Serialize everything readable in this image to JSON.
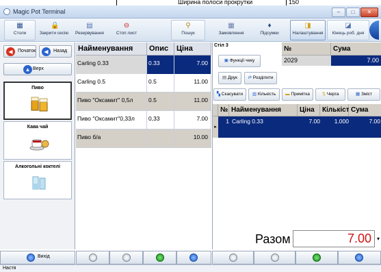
{
  "top": {
    "strip_label": "Ширина полоси прокрутки",
    "strip_value": "150"
  },
  "window": {
    "title": "Magic Pot Terminal"
  },
  "toolbar": {
    "items": [
      {
        "label": "Столи",
        "icon": "grid-icon"
      },
      {
        "label": "Закрити сесію",
        "icon": "lock-icon"
      },
      {
        "label": "Резервування",
        "icon": "calendar-icon"
      },
      {
        "label": "Стоп лист",
        "icon": "stop-icon"
      },
      {
        "label": "Пошук",
        "icon": "search-icon"
      },
      {
        "label": "Замовлення",
        "icon": "orders-icon"
      },
      {
        "label": "Підсумки",
        "icon": "totals-icon"
      },
      {
        "label": "Налаштування",
        "icon": "settings-icon"
      },
      {
        "label": "Кінець роб. дня",
        "icon": "end-day-icon"
      }
    ]
  },
  "left": {
    "start_label": "Початок",
    "back_label": "Назад",
    "up_label": "Верх",
    "exit_label": "Вихід",
    "categories": [
      "Пиво",
      "Кава чай",
      "Алкогольні коктелі"
    ]
  },
  "menu_grid": {
    "headers": [
      "Найменування",
      "Опис",
      "Ціна"
    ],
    "rows": [
      {
        "name": "Carling 0.33",
        "desc": "0.33",
        "price": "7.00"
      },
      {
        "name": "Carling 0.5",
        "desc": "0.5",
        "price": "11.00"
      },
      {
        "name": "Пиво \"Оксамит\" 0,5л",
        "desc": "0.5",
        "price": "11.00"
      },
      {
        "name": "Пиво \"Оксамит\"0,33л",
        "desc": "0,33",
        "price": "7.00"
      },
      {
        "name": "Пиво б/а",
        "desc": "",
        "price": "10.00"
      }
    ]
  },
  "order": {
    "table_label": "Стіл 3",
    "check_functions_label": "Функції чеку",
    "print_label": "Друк",
    "split_label": "Розділити",
    "cancel_label": "Скасувати",
    "quantity_label": "Кількість",
    "note_label": "Примітка",
    "queue_label": "Черга",
    "change_label": "Зміст",
    "check_header_no": "№",
    "check_header_sum": "Сума",
    "check_no": "2029",
    "check_sum": "7.00",
    "item_headers": [
      "№",
      "Найменування",
      "Ціна",
      "Кількість",
      "Сума"
    ],
    "items": [
      {
        "no": "1",
        "name": "Carling 0.33",
        "price": "7.00",
        "qty": "1.000",
        "sum": "7.00"
      }
    ],
    "total_label": "Разом",
    "total_value": "7.00"
  },
  "status": {
    "text": "Настя"
  }
}
